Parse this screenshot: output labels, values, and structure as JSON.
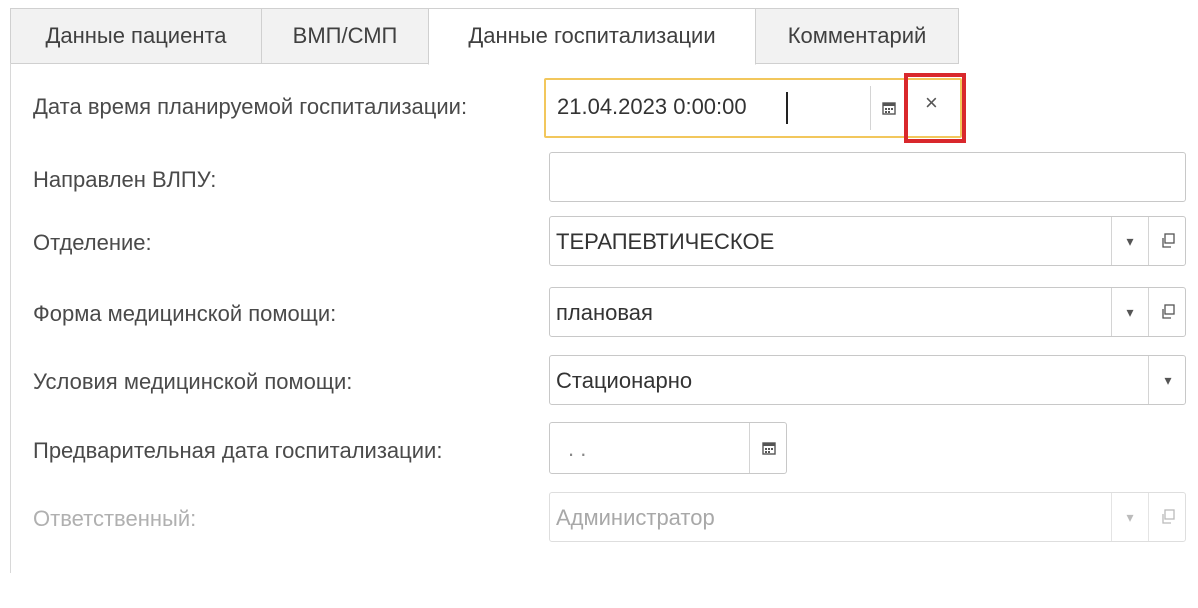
{
  "tabs": [
    {
      "label": "Данные пациента"
    },
    {
      "label": "ВМП/СМП"
    },
    {
      "label": "Данные госпитализации",
      "active": true
    },
    {
      "label": "Комментарий"
    }
  ],
  "form": {
    "planned_datetime": {
      "label": "Дата время планируемой госпитализации:",
      "value": "21.04.2023  0:00:00"
    },
    "referred_from": {
      "label": "Направлен ВЛПУ:",
      "value": ""
    },
    "department": {
      "label": "Отделение:",
      "value": "ТЕРАПЕВТИЧЕСКОЕ"
    },
    "care_form": {
      "label": "Форма медицинской помощи:",
      "value": "плановая"
    },
    "care_conditions": {
      "label": "Условия медицинской помощи:",
      "value": "Стационарно"
    },
    "preliminary_date": {
      "label": "Предварительная дата госпитализации:",
      "value": " .  .  "
    },
    "responsible": {
      "label": "Ответственный:",
      "value": "Администратор",
      "disabled": true
    }
  },
  "icons": {
    "calendar": "calendar-icon",
    "clear": "×",
    "dropdown": "▾",
    "open": "open-window-icon"
  },
  "colors": {
    "focus_border": "#f2c75c",
    "highlight_box": "#d9282c"
  }
}
